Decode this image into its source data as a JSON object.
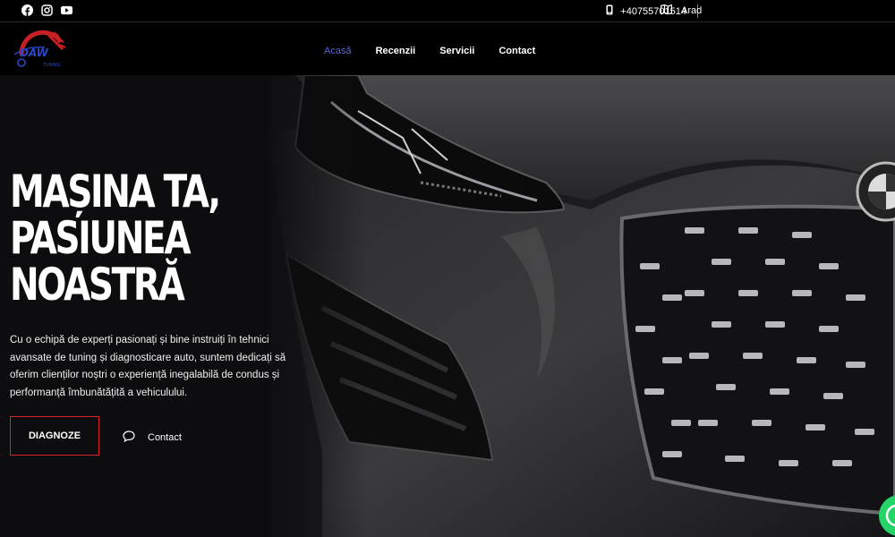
{
  "topbar": {
    "social": [
      {
        "icon": "facebook-icon"
      },
      {
        "icon": "instagram-icon"
      },
      {
        "icon": "youtube-icon"
      }
    ],
    "phone": "+40755701514",
    "location": "Arad"
  },
  "header": {
    "logo_text": "DAW",
    "logo_subtext": "TUNING",
    "nav": [
      {
        "label": "Acasă",
        "active": true
      },
      {
        "label": "Recenzii",
        "active": false
      },
      {
        "label": "Servicii",
        "active": false
      },
      {
        "label": "Contact",
        "active": false
      }
    ]
  },
  "hero": {
    "title_lines": [
      "MAȘINA TA,",
      "PASIUNEA",
      "NOASTRĂ"
    ],
    "description": "Cu o echipă de experți pasionați și bine instruiți în tehnici avansate de tuning și diagnosticare auto, suntem dedicați să oferim clienților noștri o experiență inegalabilă de condus și performanță îmbunătățită a vehiculului.",
    "cta_label": "DIAGNOZE",
    "contact_label": "Contact"
  },
  "colors": {
    "accent_red": "#d7262b",
    "nav_active": "#5b63d6",
    "whatsapp": "#25d366"
  }
}
